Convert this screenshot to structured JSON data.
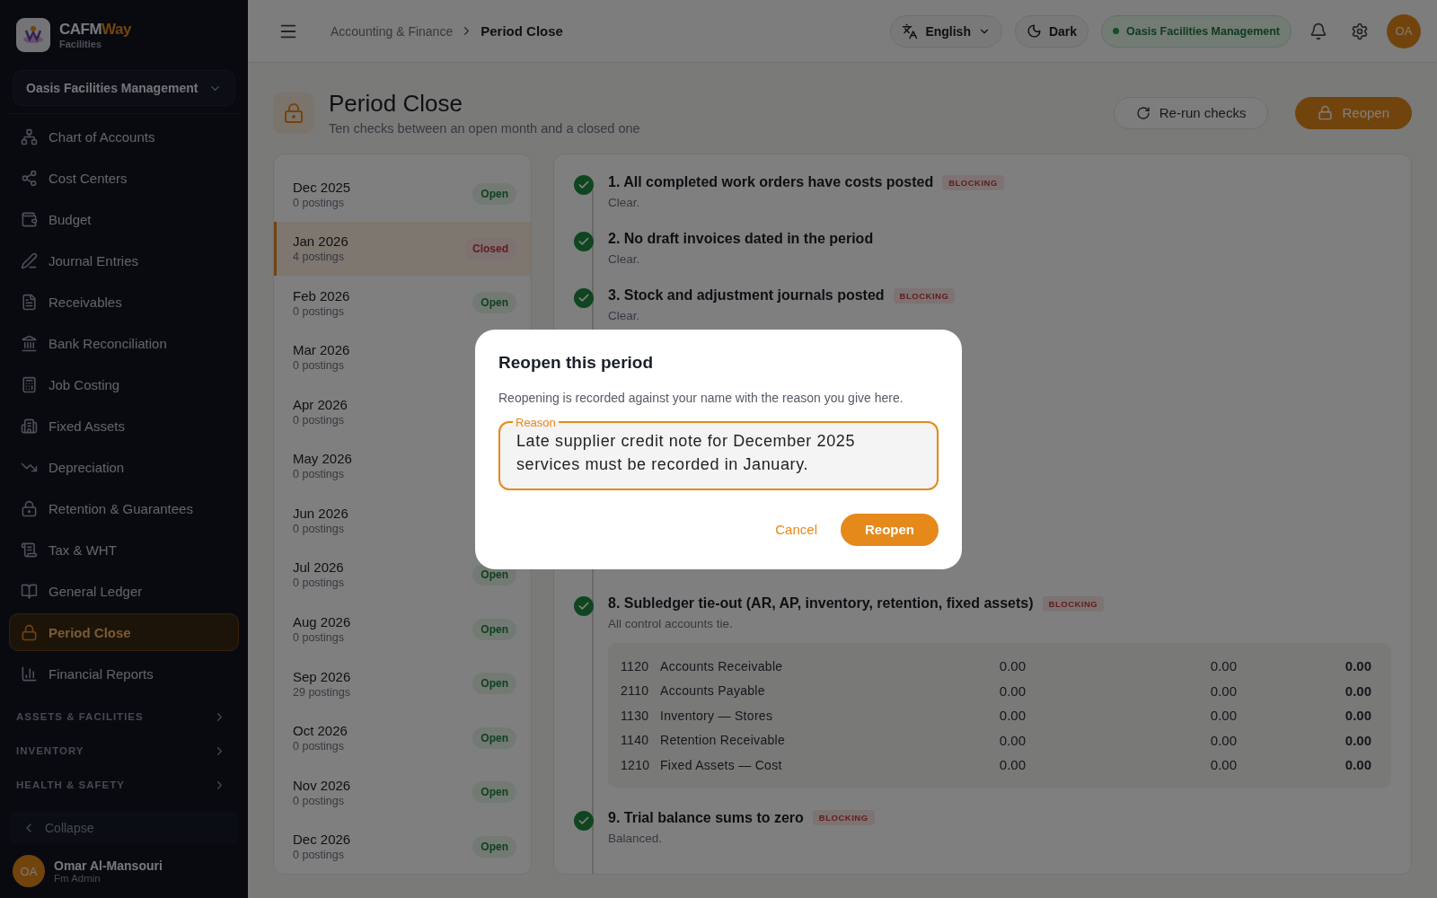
{
  "app": {
    "name_main": "CAFM",
    "name_accent": "Way",
    "subtitle": "Facilities"
  },
  "org_selector": "Oasis Facilities Management",
  "sidebar": {
    "items": [
      {
        "label": "Chart of Accounts",
        "selected": false
      },
      {
        "label": "Cost Centers",
        "selected": false
      },
      {
        "label": "Budget",
        "selected": false
      },
      {
        "label": "Journal Entries",
        "selected": false
      },
      {
        "label": "Receivables",
        "selected": false
      },
      {
        "label": "Bank Reconciliation",
        "selected": false
      },
      {
        "label": "Job Costing",
        "selected": false
      },
      {
        "label": "Fixed Assets",
        "selected": false
      },
      {
        "label": "Depreciation",
        "selected": false
      },
      {
        "label": "Retention & Guarantees",
        "selected": false
      },
      {
        "label": "Tax & WHT",
        "selected": false
      },
      {
        "label": "General Ledger",
        "selected": false
      },
      {
        "label": "Period Close",
        "selected": true
      },
      {
        "label": "Financial Reports",
        "selected": false
      }
    ],
    "sections": [
      {
        "label": "ASSETS & FACILITIES",
        "expanded": false
      },
      {
        "label": "INVENTORY",
        "expanded": false
      },
      {
        "label": "HEALTH & SAFETY",
        "expanded": false
      }
    ],
    "collapse": "Collapse",
    "user": {
      "initials": "OA",
      "name": "Omar Al-Mansouri",
      "role": "Fm Admin"
    }
  },
  "topbar": {
    "breadcrumb": [
      "Accounting & Finance",
      "Period Close"
    ],
    "language": "English",
    "theme": "Dark",
    "org": "Oasis Facilities Management",
    "avatar": "OA"
  },
  "page": {
    "title": "Period Close",
    "subtitle": "Ten checks between an open month and a closed one",
    "actions": [
      {
        "label": "Re-run checks",
        "kind": "secondary"
      },
      {
        "label": "Reopen",
        "kind": "primary"
      }
    ]
  },
  "periods": [
    {
      "month": "Dec 2025",
      "postings": "0 postings",
      "status": {
        "label": "Open",
        "kind": "open"
      },
      "selected": false
    },
    {
      "month": "Jan 2026",
      "postings": "4 postings",
      "status": {
        "label": "Closed",
        "kind": "closed"
      },
      "selected": true
    },
    {
      "month": "Feb 2026",
      "postings": "0 postings",
      "status": {
        "label": "Open",
        "kind": "open"
      },
      "selected": false
    },
    {
      "month": "Mar 2026",
      "postings": "0 postings",
      "selected": false
    },
    {
      "month": "Apr 2026",
      "postings": "0 postings",
      "selected": false
    },
    {
      "month": "May 2026",
      "postings": "0 postings",
      "selected": false
    },
    {
      "month": "Jun 2026",
      "postings": "0 postings",
      "selected": false
    },
    {
      "month": "Jul 2026",
      "postings": "0 postings",
      "status": {
        "label": "Open",
        "kind": "open"
      },
      "selected": false
    },
    {
      "month": "Aug 2026",
      "postings": "0 postings",
      "status": {
        "label": "Open",
        "kind": "open"
      },
      "selected": false
    },
    {
      "month": "Sep 2026",
      "postings": "29 postings",
      "status": {
        "label": "Open",
        "kind": "open"
      },
      "selected": false
    },
    {
      "month": "Oct 2026",
      "postings": "0 postings",
      "status": {
        "label": "Open",
        "kind": "open"
      },
      "selected": false
    },
    {
      "month": "Nov 2026",
      "postings": "0 postings",
      "status": {
        "label": "Open",
        "kind": "open"
      },
      "selected": false
    },
    {
      "month": "Dec 2026",
      "postings": "0 postings",
      "status": {
        "label": "Open",
        "kind": "open"
      },
      "selected": false
    }
  ],
  "checks": [
    {
      "title": "1. All completed work orders have costs posted",
      "badge": "BLOCKING",
      "note": "Clear.",
      "passed": true
    },
    {
      "title": "2. No draft invoices dated in the period",
      "note": "Clear.",
      "passed": true
    },
    {
      "title": "3. Stock and adjustment journals posted",
      "badge": "BLOCKING",
      "note": "Clear.",
      "passed": true
    },
    {
      "title": "8. Subledger tie-out (AR, AP, inventory, retention, fixed assets)",
      "badge": "BLOCKING",
      "note": "All control accounts tie.",
      "passed": true,
      "table": [
        {
          "code": "1120",
          "account": "Accounts Receivable",
          "values": [
            "0.00",
            "0.00",
            "0.00"
          ]
        },
        {
          "code": "2110",
          "account": "Accounts Payable",
          "values": [
            "0.00",
            "0.00",
            "0.00"
          ]
        },
        {
          "code": "1130",
          "account": "Inventory — Stores",
          "values": [
            "0.00",
            "0.00",
            "0.00"
          ]
        },
        {
          "code": "1140",
          "account": "Retention Receivable",
          "values": [
            "0.00",
            "0.00",
            "0.00"
          ]
        },
        {
          "code": "1210",
          "account": "Fixed Assets — Cost",
          "values": [
            "0.00",
            "0.00",
            "0.00"
          ]
        }
      ]
    },
    {
      "title": "9. Trial balance sums to zero",
      "badge": "BLOCKING",
      "note": "Balanced.",
      "passed": true
    }
  ],
  "dialog": {
    "title": "Reopen this period",
    "description": "Reopening is recorded against your name with the reason you give here.",
    "field": {
      "label": "Reason",
      "value": "Late supplier credit note for December 2025 services must be recorded in January."
    },
    "buttons": [
      {
        "label": "Cancel",
        "kind": "text"
      },
      {
        "label": "Reopen",
        "kind": "primary"
      }
    ]
  }
}
